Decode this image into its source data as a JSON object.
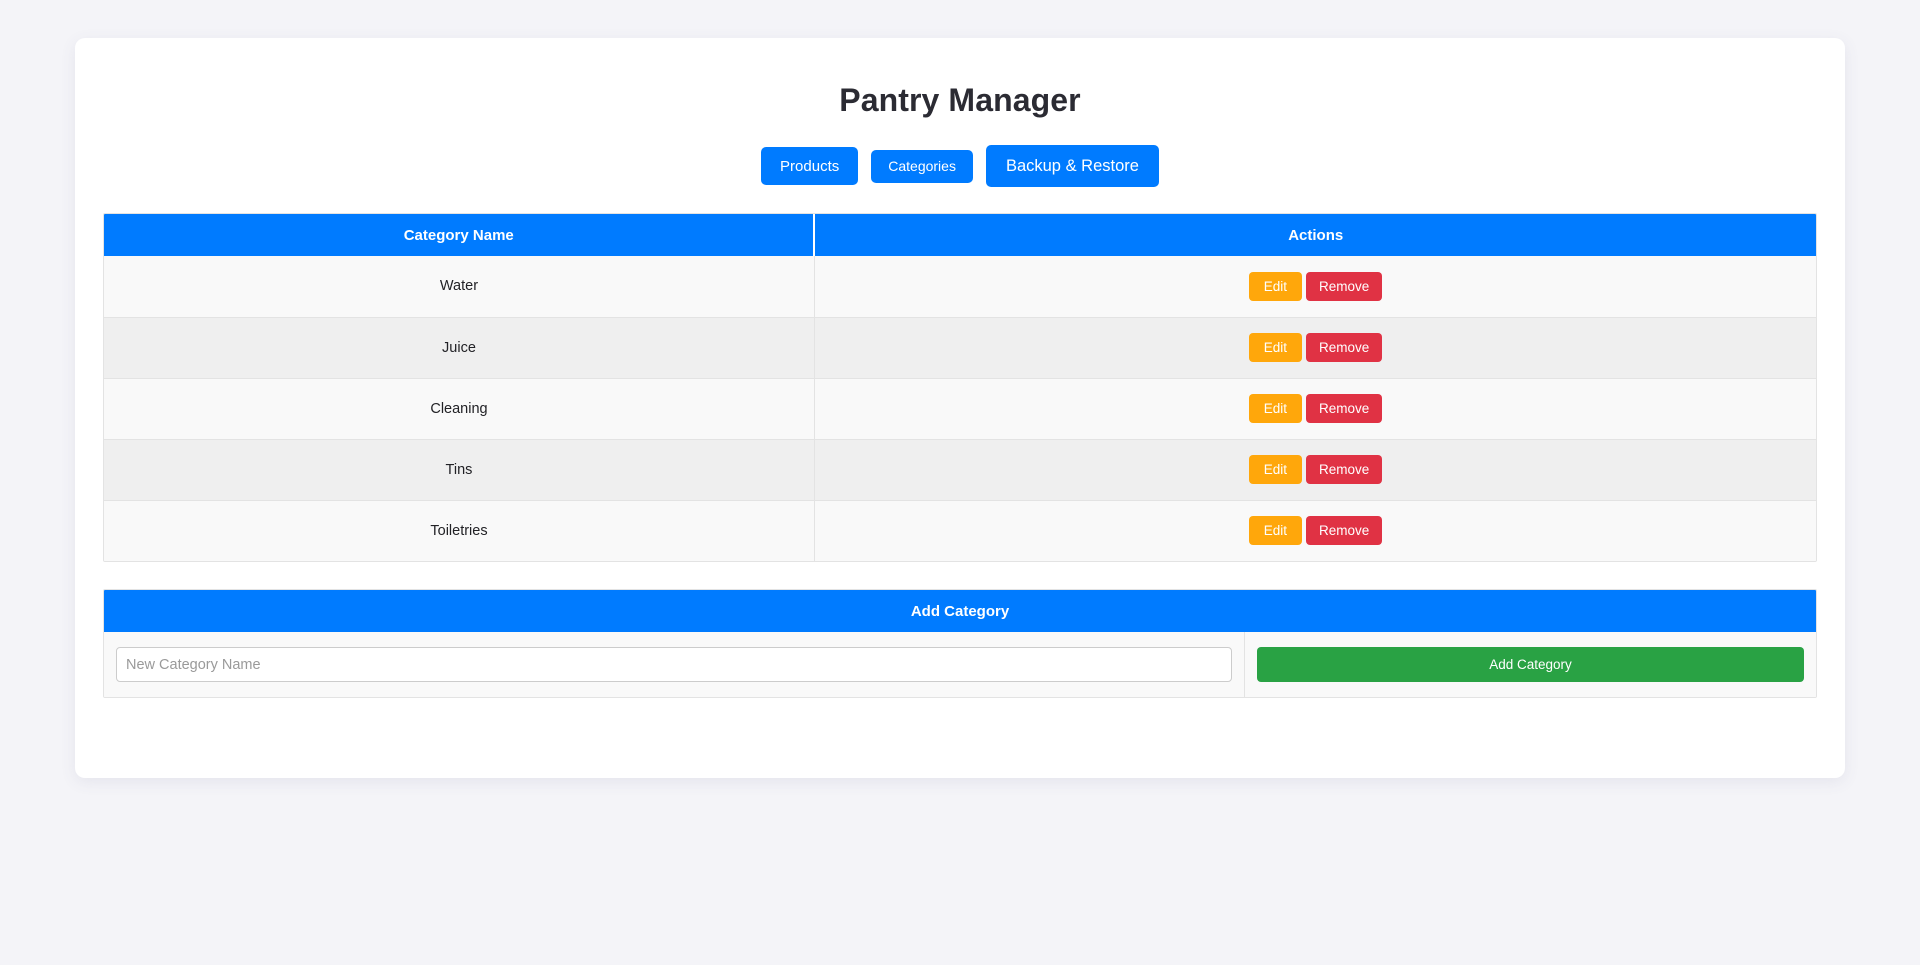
{
  "app": {
    "title": "Pantry Manager",
    "background_color": "#f4f4f8",
    "accent_color": "#007bff"
  },
  "navbar": {
    "items": [
      {
        "label": "Products",
        "size": "size-md"
      },
      {
        "label": "Categories",
        "size": "size-sm"
      },
      {
        "label": "Backup & Restore",
        "size": "size-lg"
      }
    ]
  },
  "categories_table": {
    "columns": [
      "Category Name",
      "Actions"
    ],
    "rows": [
      {
        "name": "Water",
        "edit_label": "Edit",
        "remove_label": "Remove"
      },
      {
        "name": "Juice",
        "edit_label": "Edit",
        "remove_label": "Remove"
      },
      {
        "name": "Cleaning",
        "edit_label": "Edit",
        "remove_label": "Remove"
      },
      {
        "name": "Tins",
        "edit_label": "Edit",
        "remove_label": "Remove"
      },
      {
        "name": "Toiletries",
        "edit_label": "Edit",
        "remove_label": "Remove"
      }
    ],
    "edit_color": "#ffa70b",
    "remove_color": "#e03244"
  },
  "add_category": {
    "header": "Add Category",
    "input_placeholder": "New Category Name",
    "input_value": "",
    "button_label": "Add Category",
    "button_color": "#29a244"
  }
}
